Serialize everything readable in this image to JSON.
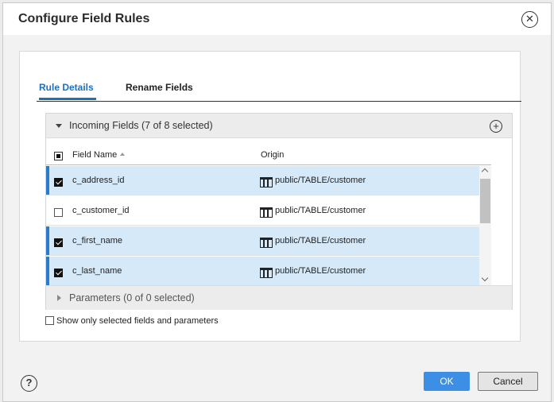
{
  "dialog": {
    "title": "Configure Field Rules",
    "close_icon": "close-icon"
  },
  "tabs": [
    {
      "label": "Rule Details",
      "active": true
    },
    {
      "label": "Rename Fields",
      "active": false
    }
  ],
  "incoming": {
    "label": "Incoming Fields (7 of 8 selected)",
    "expanded": true,
    "add_icon": "plus-circle-icon"
  },
  "columns": {
    "field_name": "Field Name",
    "origin": "Origin",
    "sort": "ascending"
  },
  "rows": [
    {
      "name": "c_address_id",
      "origin": "public/TABLE/customer",
      "checked": true
    },
    {
      "name": "c_customer_id",
      "origin": "public/TABLE/customer",
      "checked": false
    },
    {
      "name": "c_first_name",
      "origin": "public/TABLE/customer",
      "checked": true
    },
    {
      "name": "c_last_name",
      "origin": "public/TABLE/customer",
      "checked": true
    }
  ],
  "parameters": {
    "label": "Parameters (0 of 0 selected)",
    "expanded": false
  },
  "show_only": {
    "label": "Show only selected fields and parameters",
    "checked": false
  },
  "footer": {
    "help_icon": "help-icon",
    "ok_label": "OK",
    "cancel_label": "Cancel"
  },
  "colors": {
    "accent": "#1f6fbf",
    "selected_row": "#d6e9f8",
    "ok_button": "#3d8fe6"
  }
}
